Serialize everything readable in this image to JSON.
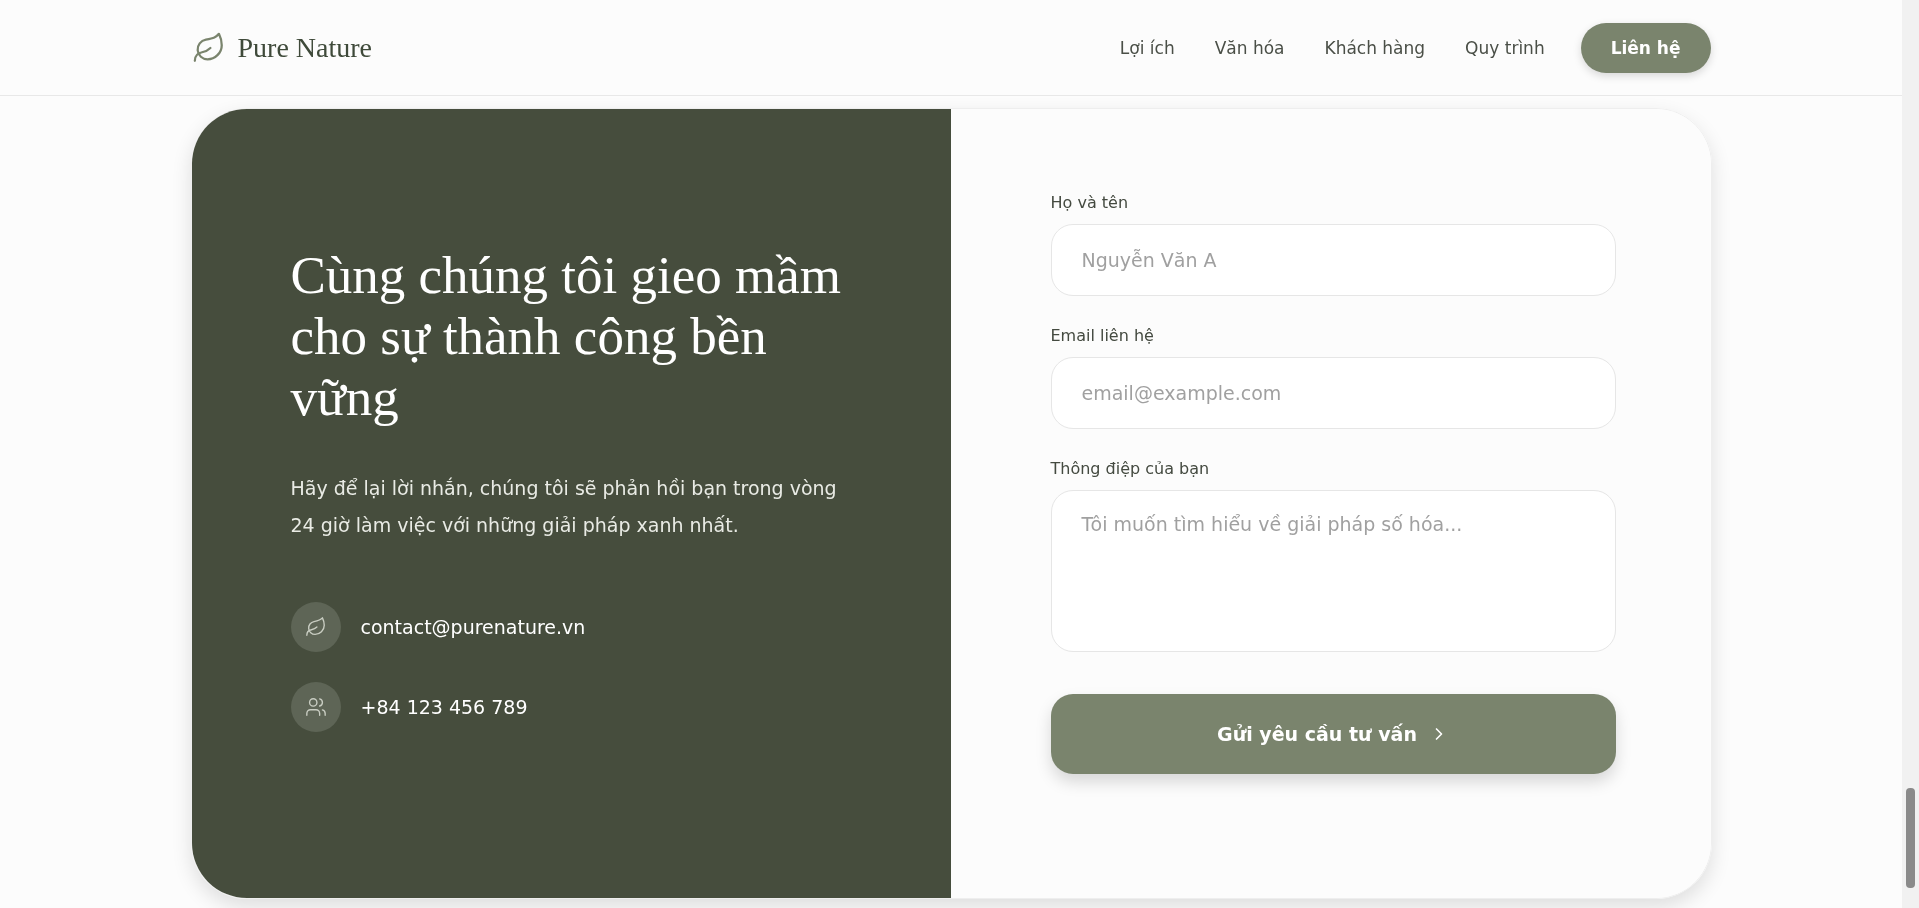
{
  "brand": {
    "name": "Pure Nature"
  },
  "nav": {
    "links": [
      "Lợi ích",
      "Văn hóa",
      "Khách hàng",
      "Quy trình"
    ],
    "cta": "Liên hệ"
  },
  "contact": {
    "heading": "Cùng chúng tôi gieo mầm cho sự thành công bền vững",
    "text": "Hãy để lại lời nhắn, chúng tôi sẽ phản hồi bạn trong vòng 24 giờ làm việc với những giải pháp xanh nhất.",
    "items": [
      {
        "kind": "email",
        "text": "contact@purenature.vn"
      },
      {
        "kind": "phone",
        "text": "+84 123 456 789"
      }
    ]
  },
  "form": {
    "fields": [
      {
        "kind": "input",
        "label": "Họ và tên",
        "placeholder": "Nguyễn Văn A"
      },
      {
        "kind": "input",
        "label": "Email liên hệ",
        "placeholder": "email@example.com"
      },
      {
        "kind": "textarea",
        "label": "Thông điệp của bạn",
        "placeholder": "Tôi muốn tìm hiểu về giải pháp số hóa..."
      }
    ],
    "submit": "Gửi yêu cầu tư vấn"
  }
}
